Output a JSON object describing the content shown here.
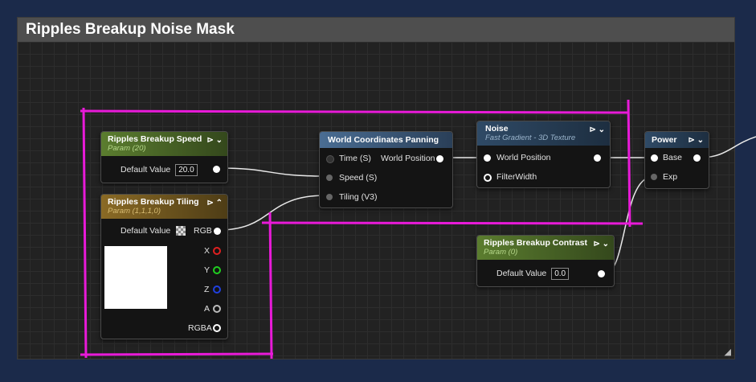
{
  "comment": {
    "title": "Ripples Breakup Noise Mask"
  },
  "nodes": {
    "speed": {
      "title": "Ripples Breakup Speed",
      "subtitle": "Param (20)",
      "label": "Default Value",
      "value": "20.0"
    },
    "tiling": {
      "title": "Ripples Breakup Tiling",
      "subtitle": "Param (1,1,1,0)",
      "label": "Default Value",
      "rgb": "RGB",
      "x": "X",
      "y": "Y",
      "z": "Z",
      "a": "A",
      "rgba": "RGBA"
    },
    "wcp": {
      "title": "World Coordinates Panning",
      "time": "Time (S)",
      "speed": "Speed (S)",
      "tiling": "Tiling (V3)",
      "out": "World Position"
    },
    "noise": {
      "title": "Noise",
      "subtitle": "Fast Gradient - 3D Texture",
      "in1": "World Position",
      "in2": "FilterWidth"
    },
    "contrast": {
      "title": "Ripples Breakup Contrast",
      "subtitle": "Param (0)",
      "label": "Default Value",
      "value": "0.0"
    },
    "power": {
      "title": "Power",
      "base": "Base",
      "exp": "Exp"
    }
  },
  "colors": {
    "highlight": "#e81ad8",
    "param_header": "#5b7d2f",
    "vector_param_header": "#8a6a25",
    "function_header": "#4a6d93",
    "noise_header": "#2f4a66",
    "pin_x": "#e02020",
    "pin_y": "#20d020",
    "pin_z": "#2040e0"
  },
  "icons": [
    "expand-arrow-icon",
    "collapse-chevron-icon",
    "preview-toggle-icon",
    "resize-grip-icon"
  ]
}
